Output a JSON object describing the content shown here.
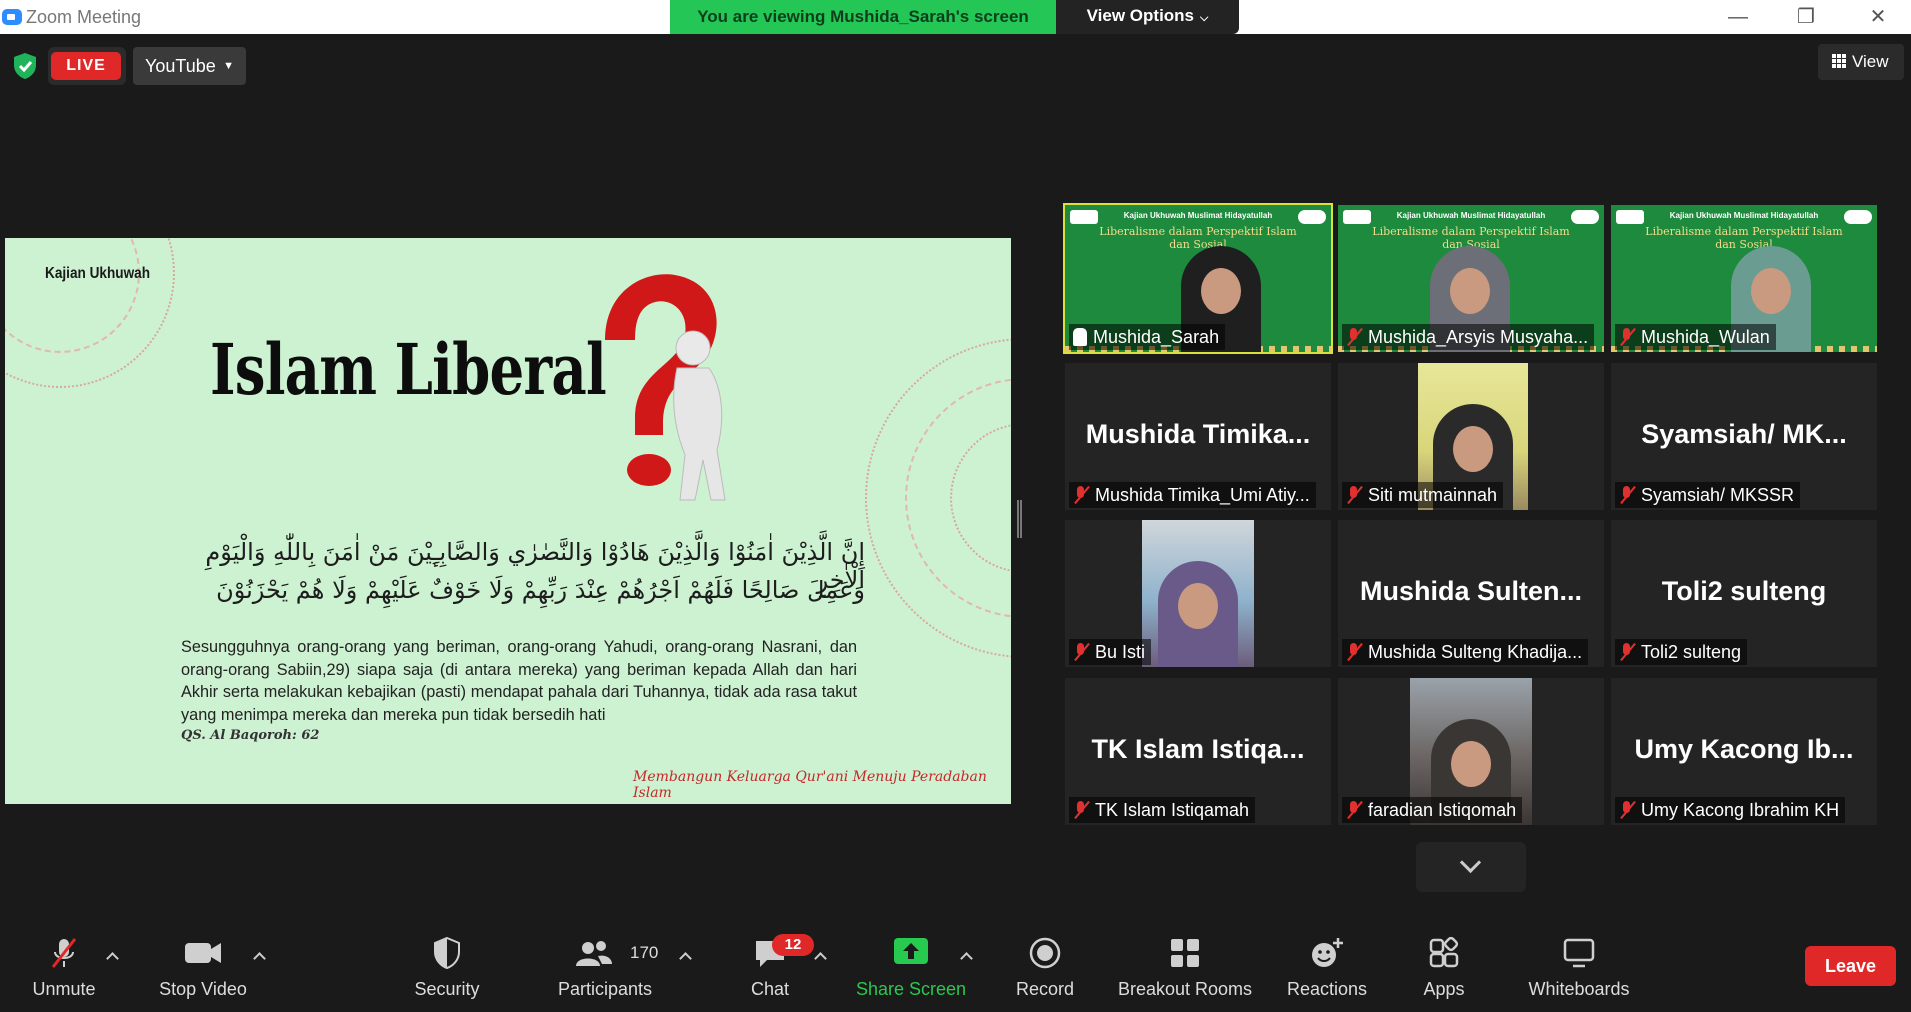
{
  "window": {
    "title": "Zoom Meeting",
    "share_banner": "You are viewing Mushida_Sarah's screen",
    "view_options": "View Options"
  },
  "topbar": {
    "live": "LIVE",
    "stream_target": "YouTube",
    "view": "View"
  },
  "slide": {
    "topic": "Kajian Ukhuwah",
    "title": "Islam Liberal",
    "arabic_line1": "إِنَّ الَّذِيْنَ اٰمَنُوْا وَالَّذِيْنَ هَادُوْا وَالنَّصٰرٰي وَالصَّابِـِٕيْنَ مَنْ اٰمَنَ بِاللّٰهِ وَالْيَوْمِ الْاٰخِرِ",
    "arabic_line2": "وَعَمِلَ صَالِحًا فَلَهُمْ اَجْرُهُمْ عِنْدَ رَبِّهِمْ وَلَا خَوْفٌ عَلَيْهِمْ وَلَا هُمْ يَحْزَنُوْنَ",
    "translation": "Sesungguhnya orang-orang yang beriman, orang-orang Yahudi, orang-orang Nasrani, dan orang-orang Sabiin,29) siapa saja (di antara mereka) yang beriman kepada Allah dan hari Akhir serta melakukan kebajikan (pasti) mendapat pahala dari Tuhannya, tidak ada rasa takut yang menimpa mereka dan mereka pun tidak bersedih hati",
    "reference": "QS. Al Baqoroh: 62",
    "tagline": "Membangun Keluarga Qur'ani Menuju Peradaban Islam"
  },
  "video_banner": {
    "header": "Kajian Ukhuwah Muslimat Hidayatullah",
    "title": "Liberalisme dalam Perspektif Islam dan Sosial"
  },
  "participants": [
    {
      "name": "Mushida_Sarah",
      "big": "",
      "active": true
    },
    {
      "name": "Mushida_Arsyis Musyaha...",
      "big": ""
    },
    {
      "name": "Mushida_Wulan",
      "big": ""
    },
    {
      "name": "Mushida Timika_Umi Atiy...",
      "big": "Mushida Timika..."
    },
    {
      "name": "Siti mutmainnah",
      "big": ""
    },
    {
      "name": "Syamsiah/ MKSSR",
      "big": "Syamsiah/ MK..."
    },
    {
      "name": "Bu Isti",
      "big": ""
    },
    {
      "name": "Mushida Sulteng Khadija...",
      "big": "Mushida Sulten..."
    },
    {
      "name": "Toli2 sulteng",
      "big": "Toli2 sulteng"
    },
    {
      "name": "TK Islam Istiqamah",
      "big": "TK Islam Istiqa..."
    },
    {
      "name": "faradian Istiqomah",
      "big": ""
    },
    {
      "name": "Umy Kacong Ibrahim KH",
      "big": "Umy Kacong Ib..."
    }
  ],
  "toolbar": {
    "unmute": "Unmute",
    "stop_video": "Stop Video",
    "security": "Security",
    "participants": "Participants",
    "participants_count": "170",
    "chat": "Chat",
    "chat_badge": "12",
    "share_screen": "Share Screen",
    "record": "Record",
    "breakout_rooms": "Breakout Rooms",
    "reactions": "Reactions",
    "apps": "Apps",
    "whiteboards": "Whiteboards",
    "leave": "Leave"
  },
  "colors": {
    "share_green": "#24c655",
    "live_red": "#e02828",
    "slide_bg": "#cdf2d2",
    "active_speaker": "#d8e23a"
  }
}
